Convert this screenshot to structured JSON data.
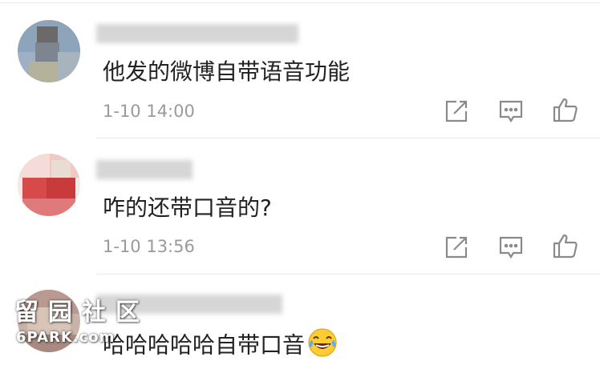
{
  "comments": [
    {
      "text": "他发的微博自带语音功能",
      "time": "1-10 14:00"
    },
    {
      "text": "咋的还带口音的?",
      "time": "1-10 13:56"
    },
    {
      "text": "哈哈哈哈哈自带口音",
      "emoji": "laughing-tears-emoji"
    }
  ],
  "actions": {
    "share_icon": "share-icon",
    "comment_icon": "comment-icon",
    "like_icon": "thumbs-up-icon"
  },
  "watermark": {
    "logo_text": "留园社区",
    "site_text": "6PARK.com"
  },
  "colors": {
    "text": "#222222",
    "timestamp": "#9a9a9a",
    "icon": "#8a8a8a",
    "divider": "#e6e6e6"
  }
}
